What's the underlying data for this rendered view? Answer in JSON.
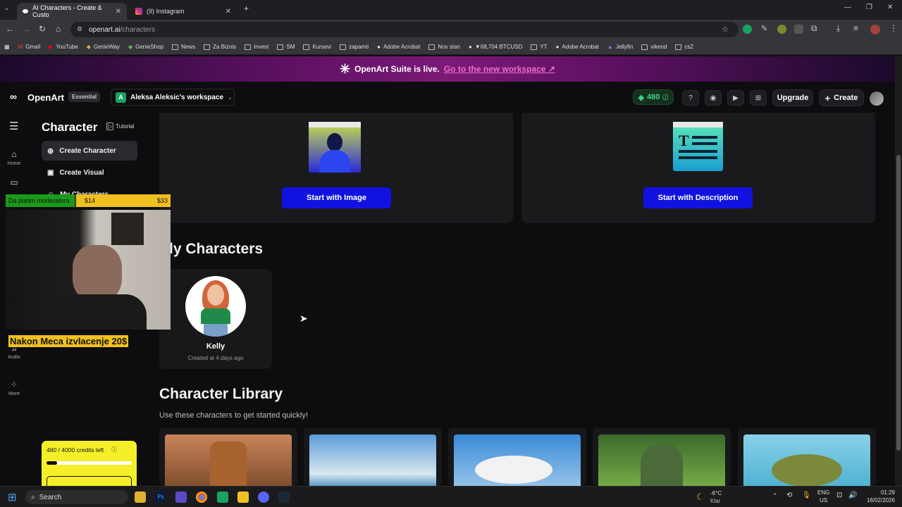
{
  "browser": {
    "tabs": [
      {
        "title": "AI Characters - Create & Custo",
        "active": true
      },
      {
        "title": "(9) Instagram",
        "active": false
      }
    ],
    "url_domain": "openart.ai",
    "url_path": "/characters",
    "bookmarks": [
      "Gmail",
      "YouTube",
      "GenieWay",
      "GenieShop",
      "News",
      "Za Biznis",
      "Invest",
      "SM",
      "Kursevi",
      "zapamti",
      "Adobe Acrobat",
      "Nov stan",
      "▼68,704 BTCUSD",
      "YT",
      "Adobe Acrobat",
      "Jellyfin",
      "vikend",
      "cs2"
    ]
  },
  "banner": {
    "text": "OpenArt Suite is live.",
    "link": "Go to the new workspace ↗"
  },
  "header": {
    "logo": "OpenArt",
    "plan_badge": "Essential",
    "workspace_initial": "A",
    "workspace_name": "Aleksa Aleksic's workspace",
    "credits": "480",
    "upgrade_label": "Upgrade",
    "create_label": "Create"
  },
  "rail": {
    "home": "Home",
    "audio": "Audio",
    "more": "More"
  },
  "sidebar": {
    "title": "Character",
    "tutorial": "Tutorial",
    "items": [
      {
        "label": "Create Character",
        "active": true
      },
      {
        "label": "Create Visual",
        "active": false
      },
      {
        "label": "My Characters",
        "active": false
      }
    ],
    "credits_text": "480 / 4000 credits left",
    "credits_fraction": 0.12
  },
  "main": {
    "start_image_label": "Start with Image",
    "start_desc_label": "Start with Description",
    "my_characters_heading": "ly Characters",
    "character": {
      "name": "Kelly",
      "created": "Created at 4 days ago"
    },
    "library_heading": "Character Library",
    "library_subtitle": "Use these characters to get started quickly!"
  },
  "overlay": {
    "goal_label": "Da platim moderatora",
    "goal_current": "$14",
    "goal_target": "$33",
    "goal_fraction": 0.42,
    "caption": "Nakon Meca izvlacenje 20$"
  },
  "taskbar": {
    "search": "Search",
    "weather_temp": "-6°C",
    "weather_desc": "Klar",
    "lang1": "ENG",
    "lang2": "US",
    "time": "01:29",
    "date": "16/02/2026"
  },
  "colors": {
    "accent_blue": "#1212e0",
    "credit_green": "#3ddc84",
    "banner_pink": "#f06cc9",
    "credits_card": "#f5ef2a"
  }
}
